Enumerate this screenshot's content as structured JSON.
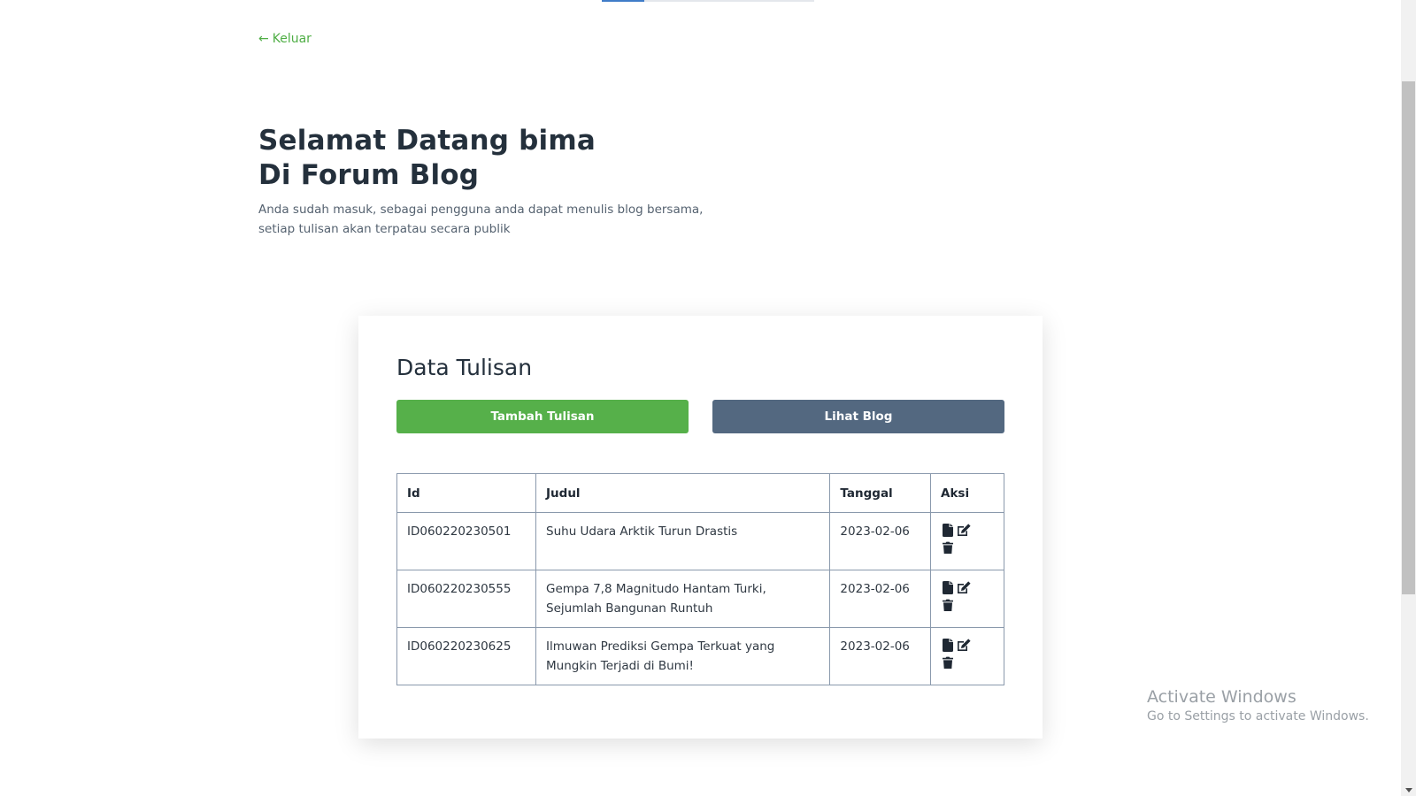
{
  "nav": {
    "back_label": "Keluar",
    "back_arrow": "←"
  },
  "hero": {
    "title_line1": "Selamat Datang bima",
    "title_line2": "Di Forum Blog",
    "desc_line1": "Anda sudah masuk, sebagai pengguna anda dapat menulis blog bersama,",
    "desc_line2": "setiap tulisan akan terpatau secara publik"
  },
  "card": {
    "title": "Data Tulisan",
    "add_button": "Tambah Tulisan",
    "view_button": "Lihat Blog",
    "table": {
      "headers": {
        "id": "Id",
        "title": "Judul",
        "date": "Tanggal",
        "actions": "Aksi"
      },
      "rows": [
        {
          "id": "ID060220230501",
          "title": "Suhu Udara Arktik Turun Drastis",
          "date": "2023-02-06"
        },
        {
          "id": "ID060220230555",
          "title": "Gempa 7,8 Magnitudo Hantam Turki, Sejumlah Bangunan Runtuh",
          "date": "2023-02-06"
        },
        {
          "id": "ID060220230625",
          "title": "Ilmuwan Prediksi Gempa Terkuat yang Mungkin Terjadi di Bumi!",
          "date": "2023-02-06"
        }
      ],
      "action_icons": [
        "file-icon",
        "edit-icon",
        "trash-icon"
      ]
    }
  },
  "watermark": {
    "title": "Activate Windows",
    "subtitle": "Go to Settings to activate Windows."
  },
  "colors": {
    "accent_green": "#56b04a",
    "button_slate": "#536880",
    "link_green": "#4fae45",
    "heading": "#24303c"
  }
}
